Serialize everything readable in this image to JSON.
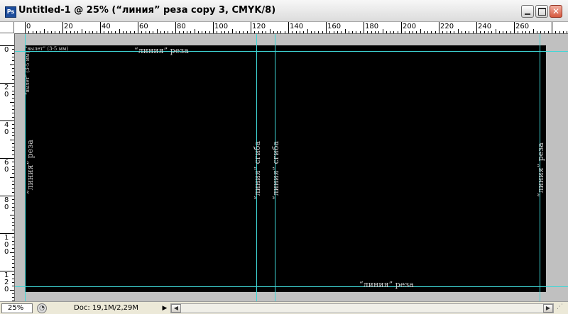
{
  "window": {
    "app_icon": "photoshop-icon",
    "app_icon_text": "Ps",
    "title": "Untitled-1 @ 25% (“линия” реза copy 3, CMYK/8)",
    "close_glyph": "✕"
  },
  "rulers": {
    "horizontal_labels": [
      "0",
      "20",
      "40",
      "60",
      "80",
      "100",
      "120",
      "140",
      "160",
      "180",
      "200",
      "220",
      "240",
      "260"
    ],
    "vertical_labels": [
      "0",
      "20",
      "40",
      "60",
      "80",
      "100",
      "120"
    ]
  },
  "canvas": {
    "guide_labels": {
      "top_cut": "“линия” реза",
      "bottom_cut": "“линия” реза",
      "left_cut": "“линия” реза",
      "right_cut": "“линия” реза",
      "spine_left": "“линия” сгиба",
      "spine_right": "“линия” сгиба",
      "bleed_top": "“вылет” (3-5 мм)",
      "bleed_left": "“вылет” (3-5 мм)"
    },
    "background_color": "#000000",
    "guide_color": "#3fd7d7"
  },
  "status": {
    "zoom": "25%",
    "doc_info": "Doc: 19,1M/2,29M",
    "menu_arrow": "▶",
    "scroll_left": "◀",
    "scroll_right": "▶"
  }
}
